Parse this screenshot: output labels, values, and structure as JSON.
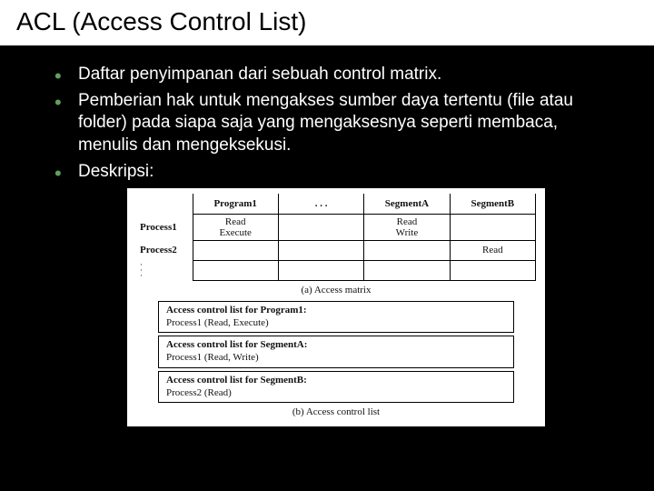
{
  "title": "ACL (Access Control List)",
  "bullets": [
    "Daftar penyimpanan dari sebuah control matrix.",
    "Pemberian hak untuk mengakses sumber daya tertentu (file atau folder) pada siapa saja yang mengaksesnya seperti membaca, menulis dan mengeksekusi.",
    "Deskripsi:"
  ],
  "matrix": {
    "cols": [
      "Program1",
      ". . .",
      "SegmentA",
      "SegmentB"
    ],
    "rows": [
      {
        "h": "Process1",
        "c": [
          "Read\nExecute",
          "",
          "Read\nWrite",
          ""
        ]
      },
      {
        "h": "Process2",
        "c": [
          "",
          "",
          "",
          "Read"
        ]
      }
    ],
    "caption": "(a) Access matrix"
  },
  "acl": [
    {
      "t": "Access control list for Program1:",
      "d": "Process1 (Read, Execute)"
    },
    {
      "t": "Access control list for SegmentA:",
      "d": "Process1 (Read, Write)"
    },
    {
      "t": "Access control list for SegmentB:",
      "d": "Process2 (Read)"
    }
  ],
  "acl_caption": "(b) Access control list"
}
